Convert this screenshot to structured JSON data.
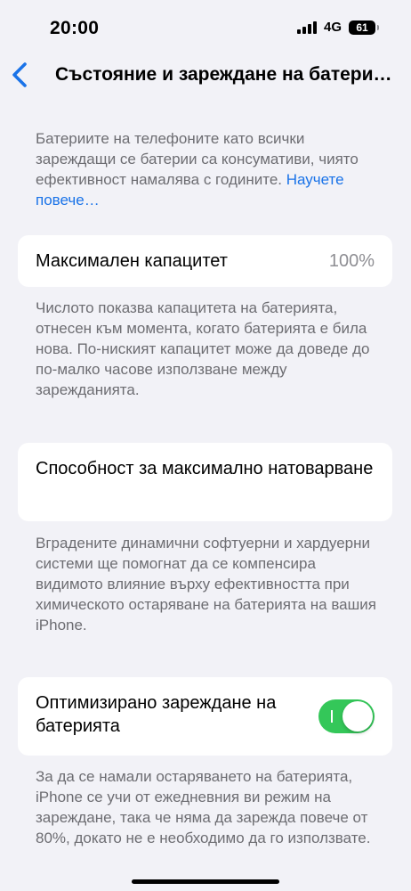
{
  "status_bar": {
    "time": "20:00",
    "network": "4G",
    "battery_level": "61"
  },
  "nav": {
    "title": "Състояние и зареждане на батерията"
  },
  "intro": {
    "text": "Батериите на телефоните като всички зареждащи се батерии са консумативи, чиято ефективност намалява с годините.",
    "link": "Научете повече…"
  },
  "max_capacity": {
    "label": "Максимален капацитет",
    "value": "100%",
    "description": "Числото показва капацитета на батерията, отнесен към момента, когато батерията е била нова. По-ниският капацитет може да доведе до по-малко часове използване между зарежданията."
  },
  "peak_performance": {
    "label": "Способност за максимално натоварване",
    "description": "Вградените динамични софтуерни и хардуерни системи ще помогнат да се компенсира видимото влияние върху ефективността при химическото остаряване на батерията на вашия iPhone."
  },
  "optimized_charging": {
    "label": "Оптимизирано зареждане на батерията",
    "enabled": true,
    "description": "За да се намали остаряването на батерията, iPhone се учи от ежедневния ви режим на зареждане, така че няма да зарежда повече от 80%, докато не е необходимо да го използвате."
  },
  "colors": {
    "accent": "#1a73e8",
    "toggle_on": "#34c759",
    "background": "#f2f2f7"
  }
}
